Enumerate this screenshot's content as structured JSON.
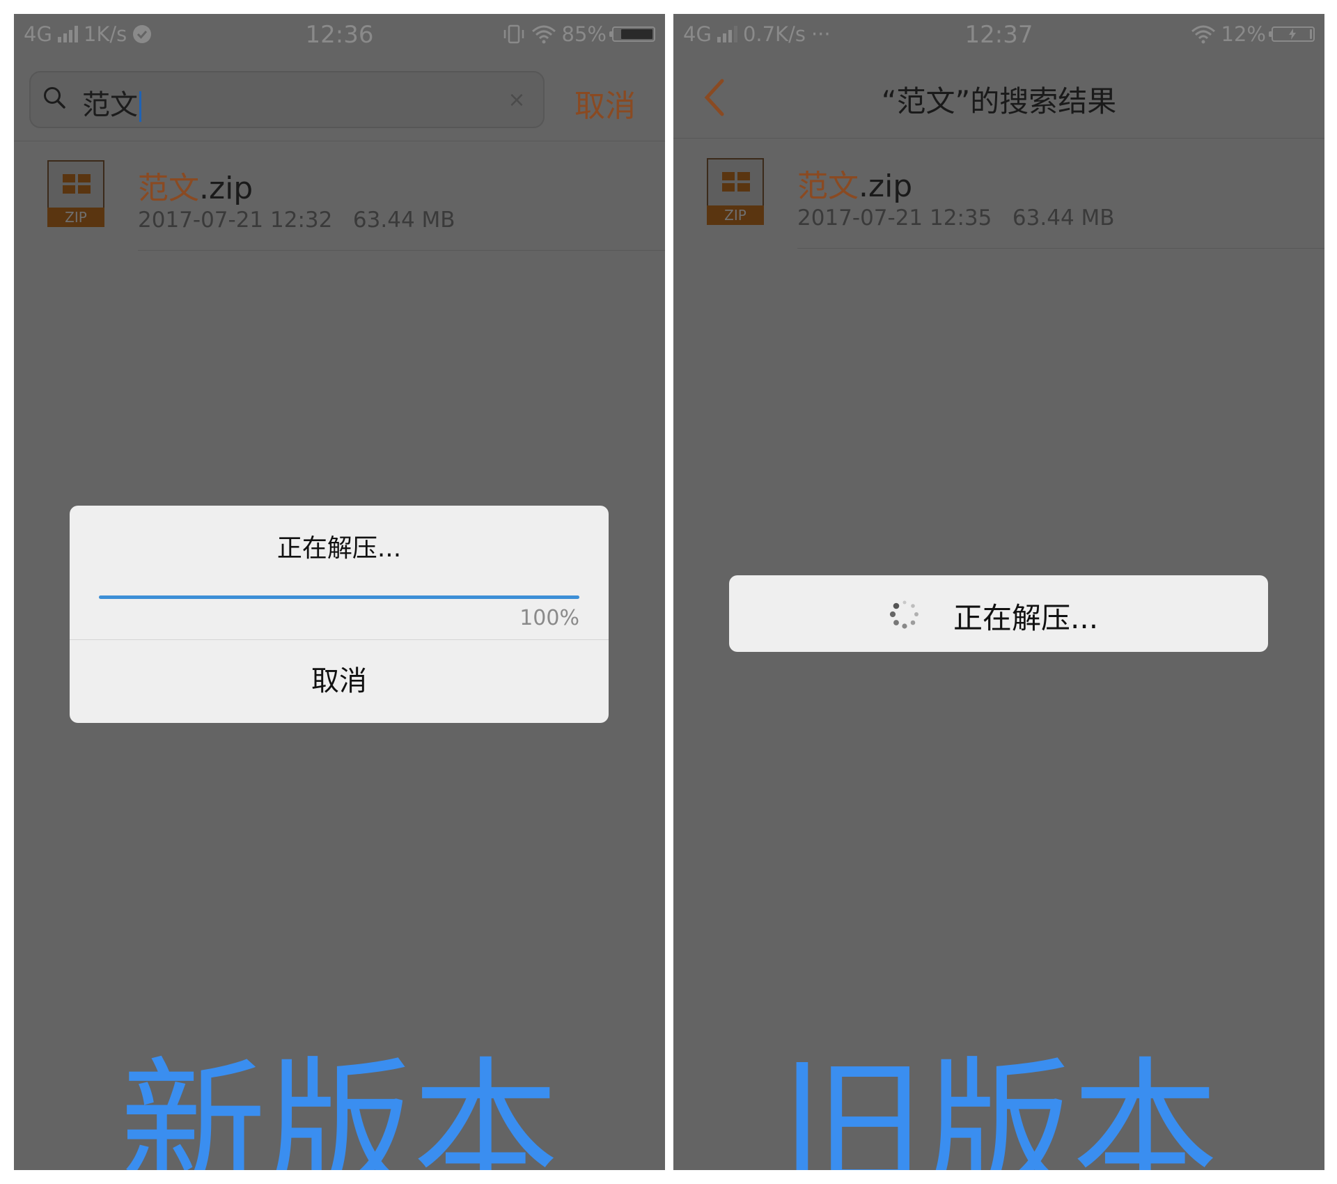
{
  "colors": {
    "accent_orange": "#8a4a22",
    "caption_blue": "#3a8ef0",
    "progress_blue": "#3d8fd6",
    "overlay_gray": "#646464",
    "dialog_bg": "#efefef"
  },
  "new_version": {
    "status_bar": {
      "network": "4G",
      "speed": "1K/s",
      "time": "12:36",
      "battery_percent": "85%",
      "battery_level": 0.85,
      "icons": [
        "signal-icon",
        "check-circle-icon",
        "vibrate-icon",
        "wifi-icon",
        "battery-icon"
      ]
    },
    "search": {
      "query": "范文",
      "cancel_label": "取消"
    },
    "file": {
      "name_highlight": "范文",
      "name_rest": ".zip",
      "icon_label": "ZIP",
      "date": "2017-07-21 12:32",
      "size": "63.44 MB"
    },
    "dialog": {
      "title": "正在解压...",
      "progress": 1.0,
      "percent_label": "100%",
      "cancel_label": "取消"
    },
    "caption": "新版本"
  },
  "old_version": {
    "status_bar": {
      "network": "4G",
      "speed": "0.7K/s",
      "more": "···",
      "time": "12:37",
      "battery_percent": "12%",
      "battery_level": 0.12,
      "icons": [
        "signal-icon",
        "wifi-icon",
        "battery-charging-icon"
      ]
    },
    "title": "“范文”的搜索结果",
    "file": {
      "name_highlight": "范文",
      "name_rest": ".zip",
      "icon_label": "ZIP",
      "date": "2017-07-21 12:35",
      "size": "63.44 MB"
    },
    "toast": {
      "text": "正在解压..."
    },
    "caption": "旧版本"
  }
}
